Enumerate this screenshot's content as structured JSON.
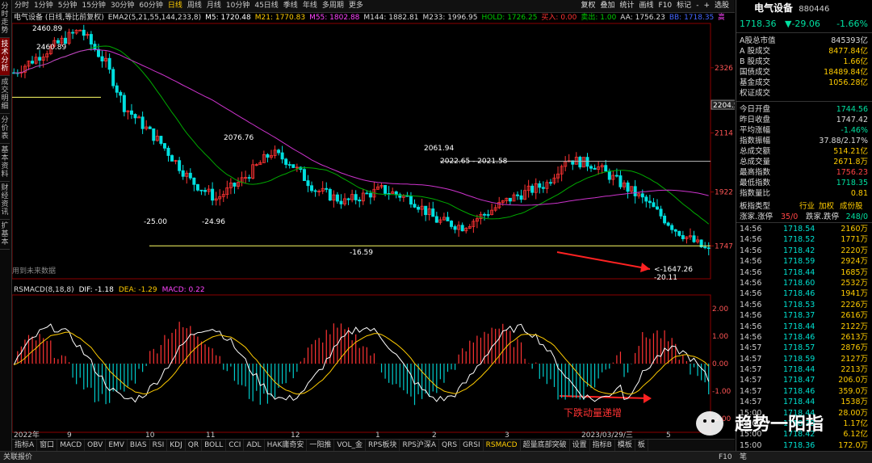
{
  "toolbar": {
    "left_tabs": [
      "分时",
      "1分钟",
      "5分钟",
      "15分钟",
      "30分钟",
      "60分钟",
      "日线",
      "周线",
      "月线",
      "10分钟",
      "45日线",
      "季线",
      "年线",
      "多周期",
      "更多"
    ],
    "active_tab": "日线",
    "right_tabs": [
      "复权",
      "叠加",
      "统计",
      "画线",
      "F10",
      "标记",
      "-",
      "+",
      "选股"
    ]
  },
  "left_tabs": [
    "分时走势",
    "技术分析",
    "成交明细",
    "分价表",
    "基本资料",
    "财经资讯",
    "扩基本"
  ],
  "legend_main": [
    {
      "text": "电气设备 (日线,等比前复权)",
      "color": "#dddddd"
    },
    {
      "text": "EMA2(5,21,55,144,233,8)",
      "color": "#dddddd"
    },
    {
      "text": "M5: 1720.48",
      "color": "#ffffff"
    },
    {
      "text": "M21: 1770.83",
      "color": "#ffcc00"
    },
    {
      "text": "M55: 1802.88",
      "color": "#ff44ff"
    },
    {
      "text": "M144: 1882.81",
      "color": "#dddddd"
    },
    {
      "text": "M233: 1996.95",
      "color": "#dddddd"
    },
    {
      "text": "HOLD: 1726.25",
      "color": "#00cc00"
    },
    {
      "text": "买入: 0.00",
      "color": "#ff3333"
    },
    {
      "text": "卖出: 1.00",
      "color": "#00cc00"
    },
    {
      "text": "AA: 1756.23",
      "color": "#dddddd"
    },
    {
      "text": "BB: 1718.35",
      "color": "#4466ff"
    },
    {
      "text": "高位 - 低价 ◇",
      "color": "#ff44ff"
    }
  ],
  "legend_macd": [
    {
      "text": "RSMACD(8,18,8)",
      "color": "#dddddd"
    },
    {
      "text": "DIF: -1.18",
      "color": "#ffffff"
    },
    {
      "text": "DEA: -1.29",
      "color": "#ffcc00"
    },
    {
      "text": "MACD: 0.22",
      "color": "#ff44ff"
    }
  ],
  "chart_labels": {
    "future_data": "用到未来数据",
    "macd_note": "下跌动量递增",
    "current_price_label": "2204.5"
  },
  "chart_data": {
    "type": "candlestick",
    "price_axis_ticks": [
      2326,
      2114,
      1922,
      1747
    ],
    "macd_axis_ticks": [
      "2.00",
      "1.00",
      "0.00",
      "-1.00",
      "-2.00"
    ],
    "x_labels": [
      "2022年",
      "9",
      "10",
      "11",
      "12",
      "1",
      "2",
      "3",
      "2023/03/29/三",
      "5"
    ],
    "annotations": [
      {
        "text": "2460.89"
      },
      {
        "text": "2460.89"
      },
      {
        "text": "2076.76"
      },
      {
        "text": "-25.00"
      },
      {
        "text": "-24.96"
      },
      {
        "text": "-16.59"
      },
      {
        "text": "2061.94"
      },
      {
        "text": "2022.65 - 2021.58"
      },
      {
        "text": "<-1647.26"
      },
      {
        "text": "-20.11"
      }
    ],
    "price_range": [
      1640,
      2470
    ],
    "macd_range": [
      -2.5,
      2.5
    ]
  },
  "indicator_tabs": [
    "指标A",
    "窗口",
    "MACD",
    "OBV",
    "EMV",
    "BIAS",
    "RSI",
    "KDJ",
    "QR",
    "BOLL",
    "CCI",
    "ADL",
    "HAK庸奇安",
    "一阳推",
    "VOL_金",
    "RPS板块",
    "RPS沪深A",
    "QRS",
    "GRSI",
    "RSMACD",
    "超量底部突破",
    "设置",
    "指标B",
    "模板",
    "板"
  ],
  "active_indicator": "RSMACD",
  "status": {
    "left": "关联报价",
    "f10": "F10",
    "right": "笔"
  },
  "panel": {
    "title": "电气设备",
    "code": "880446",
    "price": "1718.36",
    "change": "▼-29.06",
    "pct": "-1.66%",
    "stats1": [
      {
        "k": "A股总市值",
        "v": "845393亿",
        "c": "#dddddd"
      },
      {
        "k": "A 股成交",
        "v": "8477.84亿",
        "c": "#ffcc00"
      },
      {
        "k": "B 股成交",
        "v": "1.66亿",
        "c": "#ffcc00"
      },
      {
        "k": "国债成交",
        "v": "18489.84亿",
        "c": "#ffcc00"
      },
      {
        "k": "基金成交",
        "v": "1056.28亿",
        "c": "#ffcc00"
      },
      {
        "k": "权证成交",
        "v": "",
        "c": "#ffcc00"
      }
    ],
    "stats2": [
      {
        "k": "今日开盘",
        "v": "1744.56",
        "c": "#00e0a0"
      },
      {
        "k": "昨日收盘",
        "v": "1747.42",
        "c": "#dddddd"
      },
      {
        "k": "平均涨幅",
        "v": "-1.46%",
        "c": "#00e0a0"
      },
      {
        "k": "指数振幅",
        "v": "37.88/2.17%",
        "c": "#dddddd"
      },
      {
        "k": "总成交额",
        "v": "514.21亿",
        "c": "#ffcc00"
      },
      {
        "k": "总成交量",
        "v": "2671.8万",
        "c": "#ffcc00"
      },
      {
        "k": "最高指数",
        "v": "1756.23",
        "c": "#ff4444"
      },
      {
        "k": "最低指数",
        "v": "1718.35",
        "c": "#00e0a0"
      },
      {
        "k": "指数量比",
        "v": "0.81",
        "c": "#ffcc00"
      }
    ],
    "board": {
      "k": "板指类型",
      "v1": "行业",
      "v2": "加权",
      "v3": "成份股"
    },
    "updown": {
      "up_label": "涨家.涨停",
      "up_val": "35/0",
      "down_label": "跌家.跌停",
      "down_val": "248/0"
    },
    "ticks": [
      {
        "t": "14:56",
        "p": "1718.54",
        "v": "2160万"
      },
      {
        "t": "14:56",
        "p": "1718.52",
        "v": "1771万"
      },
      {
        "t": "14:56",
        "p": "1718.42",
        "v": "2220万"
      },
      {
        "t": "14:56",
        "p": "1718.59",
        "v": "2924万"
      },
      {
        "t": "14:56",
        "p": "1718.44",
        "v": "1685万"
      },
      {
        "t": "14:56",
        "p": "1718.60",
        "v": "2532万"
      },
      {
        "t": "14:56",
        "p": "1718.46",
        "v": "1941万"
      },
      {
        "t": "14:56",
        "p": "1718.53",
        "v": "2226万"
      },
      {
        "t": "14:56",
        "p": "1718.37",
        "v": "2616万"
      },
      {
        "t": "14:56",
        "p": "1718.44",
        "v": "2122万"
      },
      {
        "t": "14:56",
        "p": "1718.46",
        "v": "2613万"
      },
      {
        "t": "14:57",
        "p": "1718.57",
        "v": "2876万"
      },
      {
        "t": "14:57",
        "p": "1718.59",
        "v": "2127万"
      },
      {
        "t": "14:57",
        "p": "1718.44",
        "v": "2213万"
      },
      {
        "t": "14:57",
        "p": "1718.47",
        "v": "206.0万"
      },
      {
        "t": "14:57",
        "p": "1718.46",
        "v": "359.0万"
      },
      {
        "t": "14:57",
        "p": "1718.44",
        "v": "1538万"
      },
      {
        "t": "15:00",
        "p": "1718.44",
        "v": "28.00万"
      },
      {
        "t": "15:00",
        "p": "1718.39",
        "v": "1.17亿"
      },
      {
        "t": "15:00",
        "p": "1718.42",
        "v": "6.12亿"
      },
      {
        "t": "15:00",
        "p": "1718.36",
        "v": "172.0万"
      }
    ]
  },
  "watermark": "趋势一阳指"
}
